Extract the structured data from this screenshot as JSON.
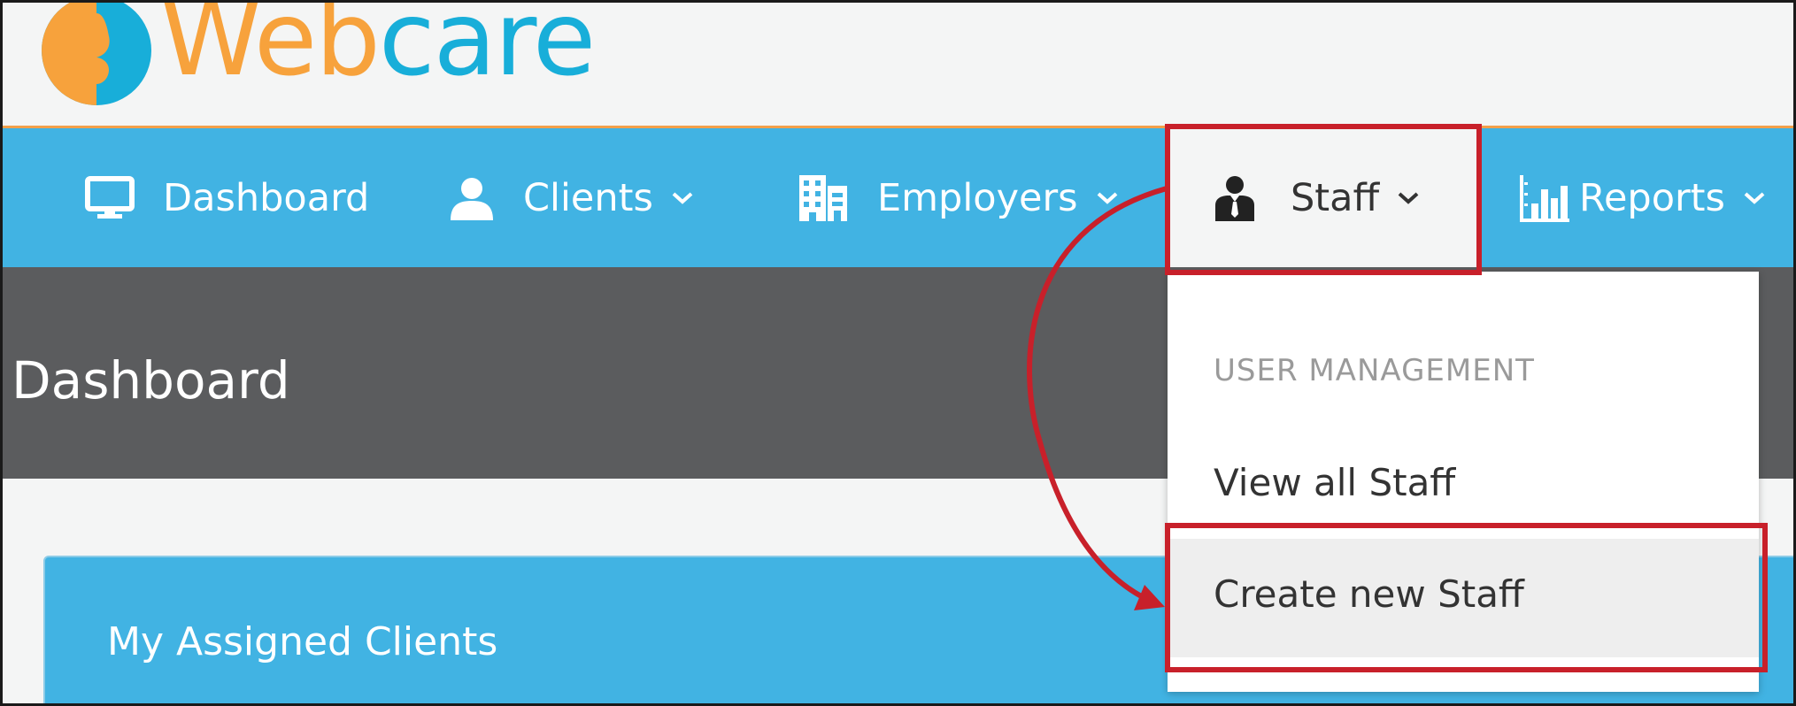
{
  "brand": {
    "name_part1": "Web",
    "name_part2": "care",
    "orange": "#f7a23c",
    "blue": "#18aed9"
  },
  "nav": {
    "items": [
      {
        "label": "Dashboard",
        "icon": "monitor-icon",
        "has_dropdown": false
      },
      {
        "label": "Clients",
        "icon": "user-icon",
        "has_dropdown": true
      },
      {
        "label": "Employers",
        "icon": "building-icon",
        "has_dropdown": true
      },
      {
        "label": "Staff",
        "icon": "staff-person-icon",
        "has_dropdown": true,
        "active": true
      },
      {
        "label": "Reports",
        "icon": "bar-chart-icon",
        "has_dropdown": true
      }
    ],
    "background": "#41b3e3"
  },
  "page": {
    "title": "Dashboard"
  },
  "panel": {
    "title": "My Assigned Clients"
  },
  "dropdown": {
    "section_header": "USER MANAGEMENT",
    "items": [
      {
        "label": "View all Staff"
      },
      {
        "label": "Create new Staff",
        "highlighted": true
      }
    ]
  },
  "annotation": {
    "highlight_color": "#c8202a"
  }
}
